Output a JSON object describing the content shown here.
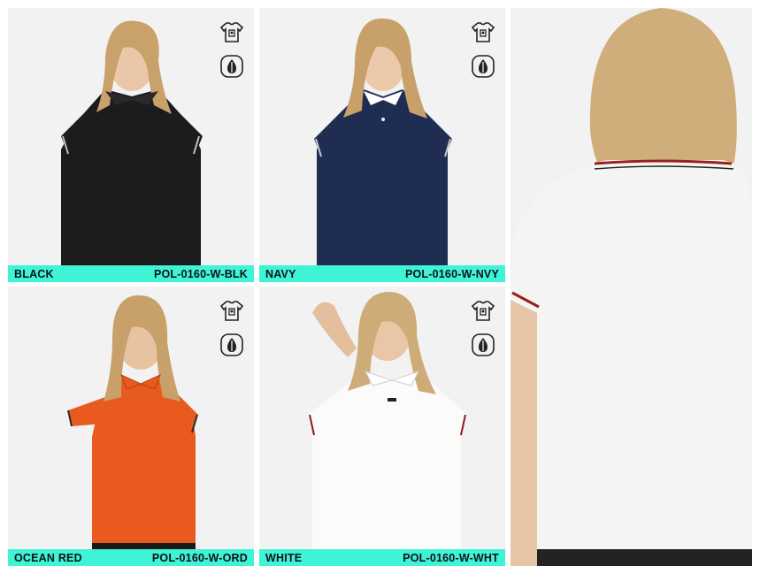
{
  "products": [
    {
      "color": "BLACK",
      "sku": "POL-0160-W-BLK",
      "shirt_color": "#1c1c1e",
      "trim_color": "#bfbfbf",
      "icons": [
        "tshirt-print-icon",
        "fabric-shield-icon"
      ]
    },
    {
      "color": "NAVY",
      "sku": "POL-0160-W-NVY",
      "shirt_color": "#1f2d52",
      "trim_color": "#c9c9c9",
      "icons": [
        "tshirt-print-icon",
        "fabric-shield-icon"
      ]
    },
    {
      "color": "OCEAN RED",
      "sku": "POL-0160-W-ORD",
      "shirt_color": "#e85a1e",
      "trim_color": "#2a2a2a",
      "icons": [
        "tshirt-print-icon",
        "fabric-shield-icon"
      ]
    },
    {
      "color": "WHITE",
      "sku": "POL-0160-W-WHT",
      "shirt_color": "#f4f4f2",
      "trim_color": "#8a1c1c",
      "icons": [
        "tshirt-print-icon",
        "fabric-shield-icon"
      ]
    }
  ],
  "back_view": {
    "shirt_color": "#f4f4f2",
    "trim_color": "#9a1f1f"
  },
  "colors": {
    "label_bar": "#3ef3d6",
    "background": "#f2f2f2"
  }
}
